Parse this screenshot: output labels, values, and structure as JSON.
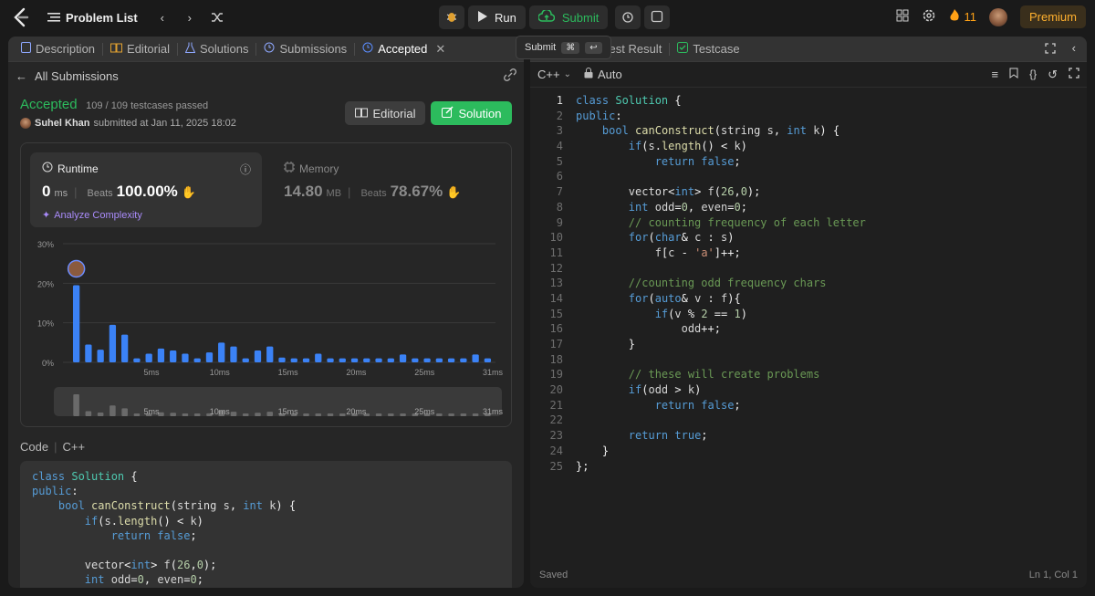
{
  "topbar": {
    "problem_list": "Problem List",
    "run": "Run",
    "submit": "Submit",
    "streak": "11",
    "premium": "Premium"
  },
  "tooltip": {
    "label": "Submit",
    "key1": "⌘",
    "key2": "↩"
  },
  "left_tabs": [
    "Description",
    "Editorial",
    "Solutions",
    "Submissions",
    "Accepted"
  ],
  "right_tabs": [
    "Test Result",
    "Testcase"
  ],
  "submission": {
    "back": "All Submissions",
    "status": "Accepted",
    "testcases": "109 / 109 testcases passed",
    "user": "Suhel Khan",
    "submitted_at": "submitted at Jan 11, 2025 18:02",
    "editorial_btn": "Editorial",
    "solution_btn": "Solution"
  },
  "runtime": {
    "label": "Runtime",
    "value": "0",
    "unit": "ms",
    "beats_label": "Beats",
    "beats": "100.00%",
    "analyze": "Analyze Complexity"
  },
  "memory": {
    "label": "Memory",
    "value": "14.80",
    "unit": "MB",
    "beats_label": "Beats",
    "beats": "78.67%"
  },
  "chart_data": {
    "type": "bar",
    "y_ticks": [
      "30%",
      "20%",
      "10%",
      "0%"
    ],
    "ylim": [
      0,
      30
    ],
    "x_ticks": [
      "5ms",
      "10ms",
      "15ms",
      "20ms",
      "25ms",
      "31ms"
    ],
    "values": [
      19.5,
      4.5,
      3.2,
      9.5,
      7,
      1,
      2.2,
      3.5,
      3,
      2.2,
      1,
      2.5,
      5,
      4,
      1,
      3,
      4,
      1.2,
      1,
      1,
      2.2,
      1,
      1,
      1,
      1,
      1,
      1,
      2,
      1,
      1,
      1,
      1,
      1,
      2,
      1
    ],
    "highlight_index": 0,
    "accent": "#3b82f6"
  },
  "code_label": "Code",
  "code_lang": "C++",
  "editor": {
    "lang": "C++",
    "mode": "Auto",
    "saved": "Saved",
    "cursor": "Ln 1, Col 1"
  },
  "code": [
    "class Solution {",
    "public:",
    "    bool canConstruct(string s, int k) {",
    "        if(s.length() < k)",
    "            return false;",
    "",
    "        vector<int> f(26,0);",
    "        int odd=0, even=0;",
    "        // counting frequency of each letter",
    "        for(char& c : s)",
    "            f[c - 'a']++;",
    "",
    "        //counting odd frequency chars",
    "        for(auto& v : f){",
    "            if(v % 2 == 1)",
    "                odd++;",
    "        }",
    "",
    "        // these will create problems",
    "        if(odd > k)",
    "            return false;",
    "",
    "        return true;",
    "    }",
    "};"
  ]
}
